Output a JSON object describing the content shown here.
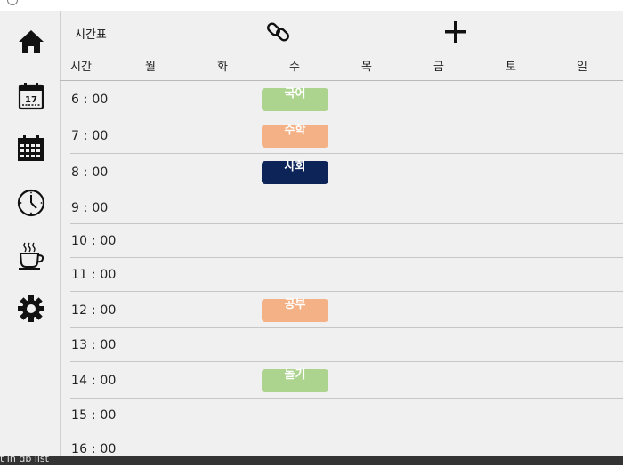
{
  "window": {
    "title": ""
  },
  "sidebar": {
    "items": [
      {
        "name": "home",
        "icon": "home-icon"
      },
      {
        "name": "calendar-day",
        "icon": "calendar-17-icon",
        "day_number": "17"
      },
      {
        "name": "calendar-month",
        "icon": "calendar-grid-icon"
      },
      {
        "name": "clock",
        "icon": "clock-icon"
      },
      {
        "name": "coffee",
        "icon": "coffee-cup-icon"
      },
      {
        "name": "settings",
        "icon": "gear-icon"
      }
    ]
  },
  "header": {
    "title": "시간표",
    "link_icon": "link-icon",
    "add_icon": "plus-icon"
  },
  "table": {
    "time_header": "시간",
    "days": [
      "월",
      "화",
      "수",
      "목",
      "금",
      "토",
      "일"
    ],
    "rows": [
      "6 : 00",
      "7 : 00",
      "8 : 00",
      "9 : 00",
      "10 : 00",
      "11 : 00",
      "12 : 00",
      "13 : 00",
      "14 : 00",
      "15 : 00",
      "16 : 00"
    ]
  },
  "events": [
    {
      "label": "국어",
      "day": "수",
      "time": "6 : 00",
      "color": "#acd48f"
    },
    {
      "label": "수학",
      "day": "수",
      "time": "7 : 00",
      "color": "#f4b185"
    },
    {
      "label": "사회",
      "day": "수",
      "time": "8 : 00",
      "color": "#0d2459"
    },
    {
      "label": "공부",
      "day": "수",
      "time": "12 : 00",
      "color": "#f4b185"
    },
    {
      "label": "놀기",
      "day": "수",
      "time": "14 : 00",
      "color": "#acd48f"
    }
  ],
  "statusbar": {
    "text": "t in db list"
  }
}
